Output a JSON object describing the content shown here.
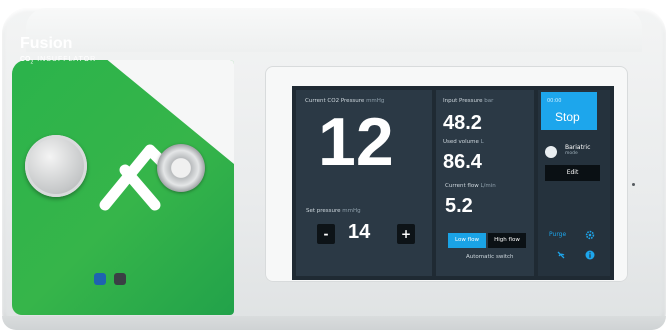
{
  "brand": {
    "name": "Fusion",
    "subtitle_prefix": "CO",
    "subtitle_sub": "2",
    "subtitle_rest": " INSUFFLATOR"
  },
  "current_pressure": {
    "label": "Current CO2 Pressure",
    "unit": "mmHg",
    "value": "12"
  },
  "set_pressure": {
    "label": "Set pressure",
    "unit": "mmHg",
    "value": "14",
    "minus_label": "-",
    "plus_label": "+"
  },
  "input_pressure": {
    "label": "Input Pressure",
    "unit": "bar",
    "value": "48.2"
  },
  "used_volume": {
    "label": "Used volume",
    "unit": "L",
    "value": "86.4"
  },
  "current_flow": {
    "label": "Current flow",
    "unit": "L/min",
    "value": "5.2"
  },
  "flow_modes": {
    "low_label": "Low flow",
    "high_label": "High flow",
    "active": "low",
    "auto_switch_label": "Automatic switch"
  },
  "controls": {
    "stop_small": "00:00",
    "stop_label": "Stop",
    "bariatric_label": "Bariatric",
    "bariatric_sub": "mode",
    "edit_label": "Edit",
    "purge_label": "Purge"
  },
  "colors": {
    "accent": "#1da6ec",
    "brand_green": "#36b54a",
    "screen_bg": "#1f2a33"
  },
  "icons": [
    "settings-gear-icon",
    "no-flow-icon",
    "info-icon",
    "purge-icon"
  ]
}
